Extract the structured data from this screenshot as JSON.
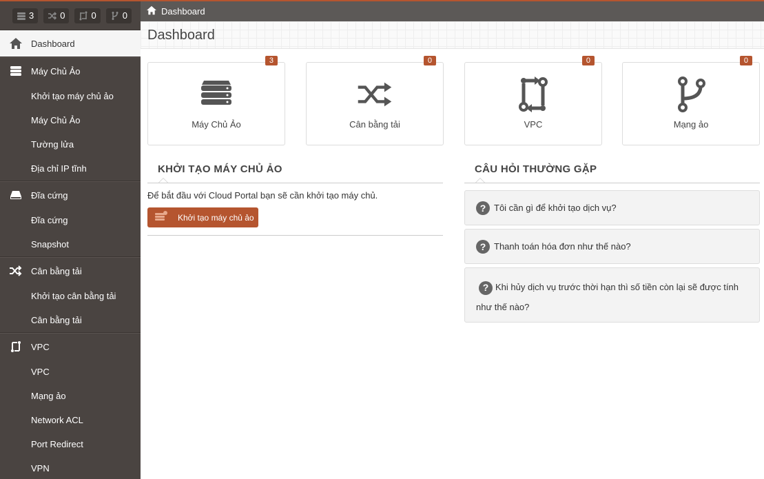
{
  "counters": [
    {
      "icon": "server-icon",
      "value": "3"
    },
    {
      "icon": "shuffle-icon",
      "value": "0"
    },
    {
      "icon": "vpc-icon",
      "value": "0"
    },
    {
      "icon": "branch-icon",
      "value": "0"
    }
  ],
  "sidebar": {
    "dashboard": "Dashboard",
    "vm": {
      "head": "Máy Chủ Ảo",
      "items": [
        "Khởi tạo máy chủ ảo",
        "Máy Chủ Ảo",
        "Tường lửa",
        "Địa chỉ IP tĩnh"
      ]
    },
    "disk": {
      "head": "Đĩa cứng",
      "items": [
        "Đĩa cứng",
        "Snapshot"
      ]
    },
    "lb": {
      "head": "Cân bằng tải",
      "items": [
        "Khởi tạo cân bằng tải",
        "Cân bằng tải"
      ]
    },
    "vpc": {
      "head": "VPC",
      "items": [
        "VPC",
        "Mạng ảo",
        "Network ACL",
        "Port Redirect",
        "VPN"
      ]
    }
  },
  "breadcrumb": "Dashboard",
  "page_title": "Dashboard",
  "cards": [
    {
      "label": "Máy Chủ Ảo",
      "badge": "3",
      "icon": "server-icon"
    },
    {
      "label": "Cân bằng tải",
      "badge": "0",
      "icon": "shuffle-icon"
    },
    {
      "label": "VPC",
      "badge": "0",
      "icon": "vpc-icon"
    },
    {
      "label": "Mạng ảo",
      "badge": "0",
      "icon": "branch-icon"
    }
  ],
  "create_section": {
    "title": "KHỞI TẠO MÁY CHỦ ẢO",
    "intro": "Để bắt đầu với Cloud Portal bạn sẽ cần khởi tạo máy chủ.",
    "button": "Khởi tạo máy chủ ảo"
  },
  "faq_section": {
    "title": "CÂU HỎI THƯỜNG GẶP",
    "items": [
      "Tôi cần gì để khởi tạo dịch vụ?",
      "Thanh toán hóa đơn như thế nào?",
      "Khi hủy dịch vụ trước thời hạn thì số tiền còn lại sẽ được tính như thế nào?"
    ]
  },
  "colors": {
    "accent": "#b5552f",
    "sidebar": "#4a4441",
    "topbar": "#5c5957"
  }
}
